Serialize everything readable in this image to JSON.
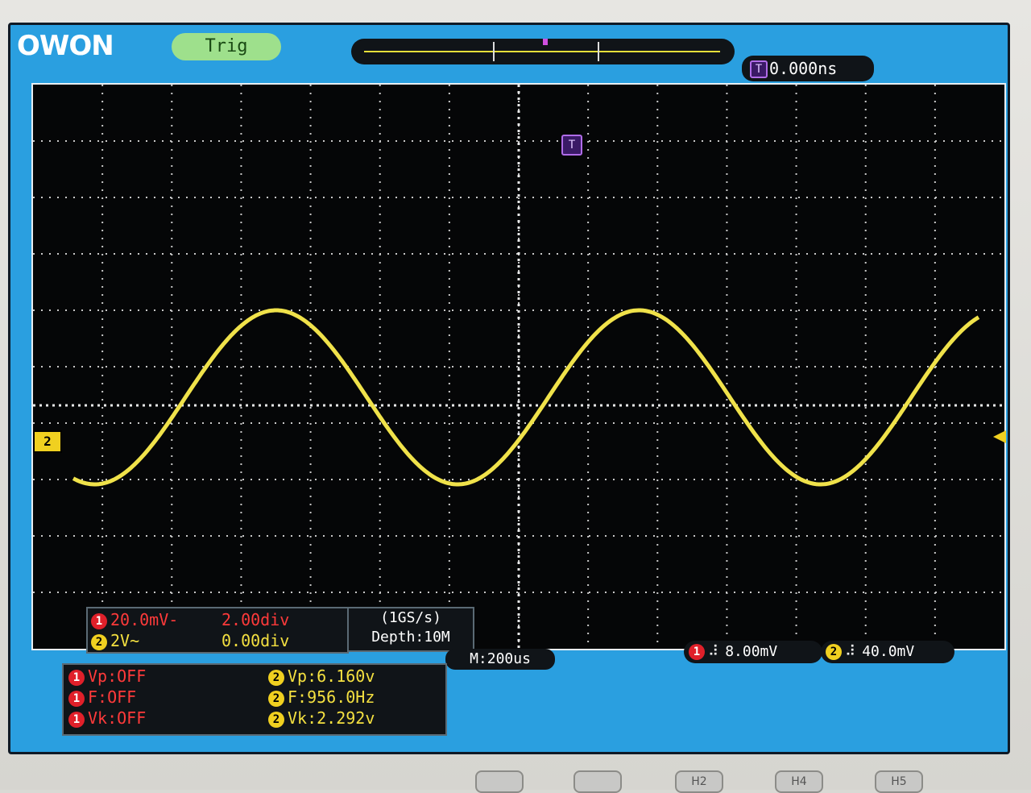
{
  "brand": "OWON",
  "status": {
    "trigger_status": "Trig"
  },
  "trigger_position": {
    "value": "0.000ns"
  },
  "markers": {
    "trigger_marker": "T",
    "ch2_ground_marker": "2"
  },
  "channel1": {
    "id": "1",
    "volts_per_div": "20.0mV",
    "coupling": "-",
    "offset": "2.00div"
  },
  "channel2": {
    "id": "2",
    "volts_per_div": "2V",
    "coupling": "~",
    "offset": "0.00div"
  },
  "acquisition": {
    "sample_rate": "(1GS/s)",
    "depth": "Depth:10M"
  },
  "timebase": {
    "main": "M:200us"
  },
  "triggers": {
    "ch1": {
      "id": "1",
      "level": "8.00mV"
    },
    "ch2": {
      "id": "2",
      "level": "40.0mV"
    }
  },
  "measurements": {
    "ch1": [
      "Vp:OFF",
      "F:OFF",
      "Vk:OFF"
    ],
    "ch2": [
      "Vp:6.160v",
      "F:956.0Hz",
      "Vk:2.292v"
    ]
  },
  "icons": {
    "trigger_edge": "rising-edge-icon",
    "trigger_time": "trigger-t-icon"
  },
  "colors": {
    "ch1": "#e0202a",
    "ch2": "#f0d020",
    "screen_bezel": "#2a9fe0",
    "grid_bg": "#050607"
  },
  "soft_buttons": [
    "",
    "",
    "H2",
    "H4",
    "H5"
  ]
}
